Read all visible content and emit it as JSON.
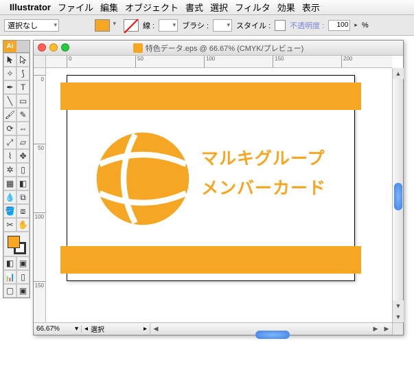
{
  "menubar": {
    "app": "Illustrator",
    "items": [
      "ファイル",
      "編集",
      "オブジェクト",
      "書式",
      "選択",
      "フィルタ",
      "効果",
      "表示"
    ]
  },
  "optbar": {
    "selection": "選択なし",
    "stroke_label": "線 :",
    "stroke_weight": "",
    "brush_label": "ブラシ :",
    "style_label": "スタイル :",
    "opacity_label": "不透明度 :",
    "opacity_value": "100",
    "opacity_unit": "%"
  },
  "toolbox": {
    "tab": "Ai"
  },
  "document": {
    "title": "特色データ.eps @ 66.67% (CMYK/プレビュー)",
    "zoom": "66.67%",
    "status_label": "選択",
    "rulerH": [
      "0",
      "50",
      "100",
      "150",
      "200"
    ],
    "rulerV": [
      "0",
      "50",
      "100",
      "150"
    ],
    "card": {
      "line1": "マルキグループ",
      "line2": "メンバーカード"
    },
    "accent": "#f5a623"
  }
}
